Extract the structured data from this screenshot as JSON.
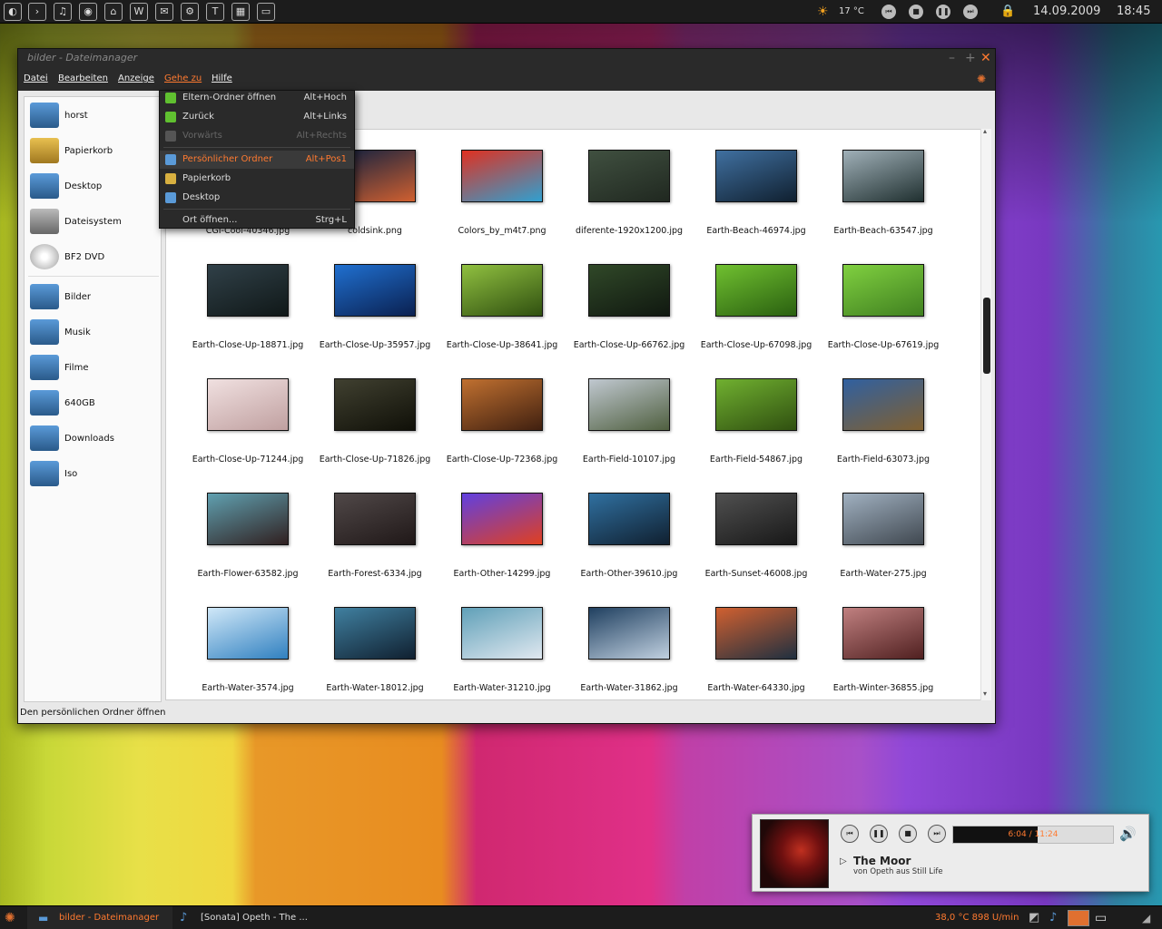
{
  "top_panel": {
    "launchers": [
      "app-launcher-1",
      "app-launcher-2",
      "music-launcher",
      "app-launcher-4",
      "app-launcher-5",
      "app-launcher-6",
      "app-launcher-7",
      "app-launcher-8",
      "app-launcher-9",
      "app-launcher-10",
      "app-launcher-11"
    ],
    "temperature": "17 °C",
    "date": "14.09.2009",
    "time": "18:45"
  },
  "window": {
    "title": "bilder - Dateimanager",
    "menu": [
      "Datei",
      "Bearbeiten",
      "Anzeige",
      "Gehe zu",
      "Hilfe"
    ],
    "active_menu": "Gehe zu"
  },
  "dropdown": {
    "items": [
      {
        "label": "Eltern-Ordner öffnen",
        "shortcut": "Alt+Hoch",
        "icon": "arrow-up-icon",
        "disabled": false
      },
      {
        "label": "Zurück",
        "shortcut": "Alt+Links",
        "icon": "arrow-left-icon",
        "disabled": false
      },
      {
        "label": "Vorwärts",
        "shortcut": "Alt+Rechts",
        "icon": "arrow-right-icon",
        "disabled": true
      },
      {
        "label": "Persönlicher Ordner",
        "shortcut": "Alt+Pos1",
        "icon": "home-folder-icon",
        "highlighted": true
      },
      {
        "label": "Papierkorb",
        "shortcut": "",
        "icon": "trash-icon"
      },
      {
        "label": "Desktop",
        "shortcut": "",
        "icon": "desktop-icon"
      },
      {
        "label": "Ort öffnen...",
        "shortcut": "Strg+L",
        "icon": ""
      }
    ]
  },
  "sidebar": {
    "places": [
      {
        "label": "horst",
        "icon": "home-folder-icon",
        "color": "#5a9ad8"
      },
      {
        "label": "Papierkorb",
        "icon": "trash-icon",
        "color": "#d8b040"
      },
      {
        "label": "Desktop",
        "icon": "desktop-folder-icon",
        "color": "#5a9ad8"
      },
      {
        "label": "Dateisystem",
        "icon": "harddisk-icon",
        "color": "#999999"
      },
      {
        "label": "BF2 DVD",
        "icon": "dvd-icon",
        "color": "#dddddd"
      }
    ],
    "bookmarks": [
      {
        "label": "Bilder",
        "icon": "pictures-folder-icon",
        "color": "#5a9ad8"
      },
      {
        "label": "Musik",
        "icon": "music-folder-icon",
        "color": "#5a9ad8"
      },
      {
        "label": "Filme",
        "icon": "video-folder-icon",
        "color": "#5a9ad8"
      },
      {
        "label": "640GB",
        "icon": "drive-folder-icon",
        "color": "#5a9ad8"
      },
      {
        "label": "Downloads",
        "icon": "downloads-folder-icon",
        "color": "#5a9ad8"
      },
      {
        "label": "Iso",
        "icon": "iso-folder-icon",
        "color": "#5a9ad8"
      }
    ]
  },
  "files": [
    {
      "name": "CGI-Cool-40346.jpg",
      "colors": [
        "#603020",
        "#201010"
      ]
    },
    {
      "name": "coldsink.png",
      "colors": [
        "#102040",
        "#d06030"
      ]
    },
    {
      "name": "Colors_by_m4t7.png",
      "colors": [
        "#e03020",
        "#30a0d0"
      ]
    },
    {
      "name": "diferente-1920x1200.jpg",
      "colors": [
        "#405040",
        "#202820"
      ]
    },
    {
      "name": "Earth-Beach-46974.jpg",
      "colors": [
        "#4070a0",
        "#102030"
      ]
    },
    {
      "name": "Earth-Beach-63547.jpg",
      "colors": [
        "#a0b0b8",
        "#203030"
      ]
    },
    {
      "name": "Earth-Close-Up-18871.jpg",
      "colors": [
        "#304048",
        "#101818"
      ]
    },
    {
      "name": "Earth-Close-Up-35957.jpg",
      "colors": [
        "#2070d0",
        "#0a2050"
      ]
    },
    {
      "name": "Earth-Close-Up-38641.jpg",
      "colors": [
        "#90c040",
        "#305010"
      ]
    },
    {
      "name": "Earth-Close-Up-66762.jpg",
      "colors": [
        "#304828",
        "#101810"
      ]
    },
    {
      "name": "Earth-Close-Up-67098.jpg",
      "colors": [
        "#70c030",
        "#2a6010"
      ]
    },
    {
      "name": "Earth-Close-Up-67619.jpg",
      "colors": [
        "#80d040",
        "#408020"
      ]
    },
    {
      "name": "Earth-Close-Up-71244.jpg",
      "colors": [
        "#f0e0e0",
        "#c0a0a0"
      ]
    },
    {
      "name": "Earth-Close-Up-71826.jpg",
      "colors": [
        "#404030",
        "#101008"
      ]
    },
    {
      "name": "Earth-Close-Up-72368.jpg",
      "colors": [
        "#c07030",
        "#402010"
      ]
    },
    {
      "name": "Earth-Field-10107.jpg",
      "colors": [
        "#c0c8d0",
        "#506040"
      ]
    },
    {
      "name": "Earth-Field-54867.jpg",
      "colors": [
        "#70b030",
        "#305010"
      ]
    },
    {
      "name": "Earth-Field-63073.jpg",
      "colors": [
        "#3060a0",
        "#806030"
      ]
    },
    {
      "name": "Earth-Flower-63582.jpg",
      "colors": [
        "#60a0b0",
        "#302020"
      ]
    },
    {
      "name": "Earth-Forest-6334.jpg",
      "colors": [
        "#504848",
        "#201818"
      ]
    },
    {
      "name": "Earth-Other-14299.jpg",
      "colors": [
        "#6040e0",
        "#e04020"
      ]
    },
    {
      "name": "Earth-Other-39610.jpg",
      "colors": [
        "#3070a0",
        "#102030"
      ]
    },
    {
      "name": "Earth-Sunset-46008.jpg",
      "colors": [
        "#505050",
        "#181818"
      ]
    },
    {
      "name": "Earth-Water-275.jpg",
      "colors": [
        "#a0b0c0",
        "#404850"
      ]
    },
    {
      "name": "Earth-Water-3574.jpg",
      "colors": [
        "#d0e8f8",
        "#3080c0"
      ]
    },
    {
      "name": "Earth-Water-18012.jpg",
      "colors": [
        "#4080a0",
        "#102030"
      ]
    },
    {
      "name": "Earth-Water-31210.jpg",
      "colors": [
        "#60a0b8",
        "#e0e8f0"
      ]
    },
    {
      "name": "Earth-Water-31862.jpg",
      "colors": [
        "#204060",
        "#c0d0e0"
      ]
    },
    {
      "name": "Earth-Water-64330.jpg",
      "colors": [
        "#d06030",
        "#203040"
      ]
    },
    {
      "name": "Earth-Winter-36855.jpg",
      "colors": [
        "#c08080",
        "#502020"
      ]
    }
  ],
  "statusbar": "Den persönlichen Ordner öffnen",
  "player": {
    "progress_text": "6:04 / 11:24",
    "progress_fraction": 0.53,
    "title": "The Moor",
    "subtitle": "von Opeth aus Still Life"
  },
  "bottom_panel": {
    "task1": "bilder - Dateimanager",
    "task2": "[Sonata] Opeth - The ...",
    "sensor": "38,0 °C  898 U/min"
  },
  "colors": {
    "accent": "#ff7a30",
    "panel": "#1c1c1c"
  }
}
